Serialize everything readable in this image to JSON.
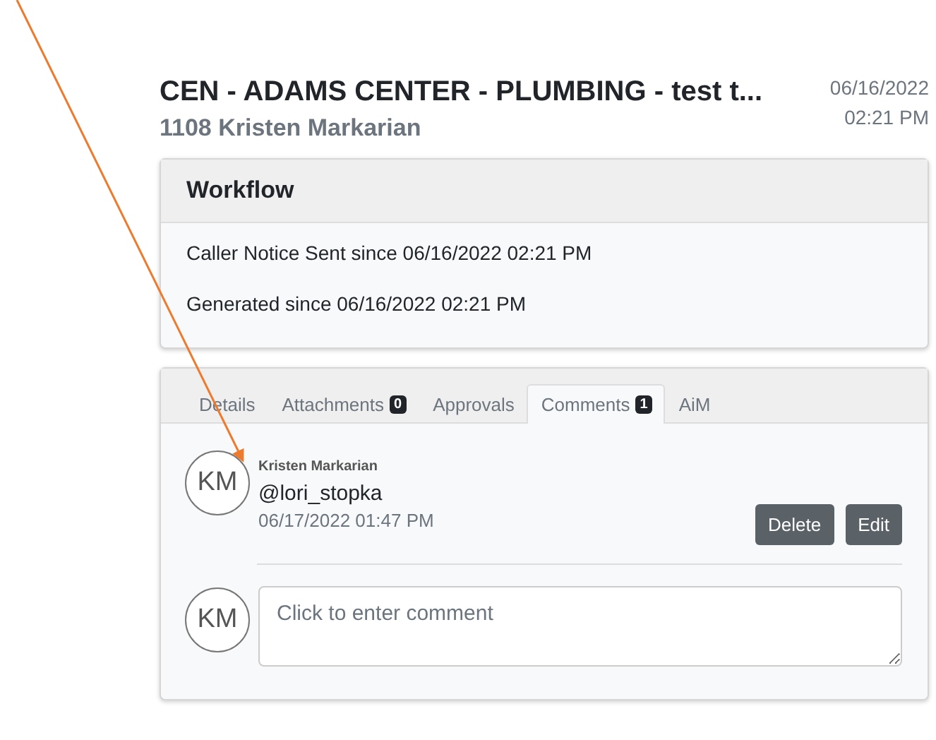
{
  "header": {
    "title": "CEN - ADAMS CENTER - PLUMBING - test t...",
    "subtitle": "1108 Kristen Markarian",
    "date": "06/16/2022",
    "time": "02:21 PM"
  },
  "workflow": {
    "title": "Workflow",
    "entries": [
      "Caller Notice Sent since 06/16/2022 02:21 PM",
      "Generated since 06/16/2022 02:21 PM"
    ]
  },
  "tabs": [
    {
      "label": "Details",
      "selected": false
    },
    {
      "label": "Attachments",
      "badge": "0",
      "selected": false
    },
    {
      "label": "Approvals",
      "selected": false
    },
    {
      "label": "Comments",
      "badge": "1",
      "selected": true
    },
    {
      "label": "AiM",
      "selected": false
    }
  ],
  "comments": [
    {
      "initials": "KM",
      "author": "Kristen Markarian",
      "text": "@lori_stopka",
      "date": "06/17/2022 01:47 PM",
      "actions": [
        "Delete",
        "Edit"
      ]
    }
  ],
  "new_comment": {
    "initials": "KM",
    "placeholder": "Click to enter comment"
  }
}
